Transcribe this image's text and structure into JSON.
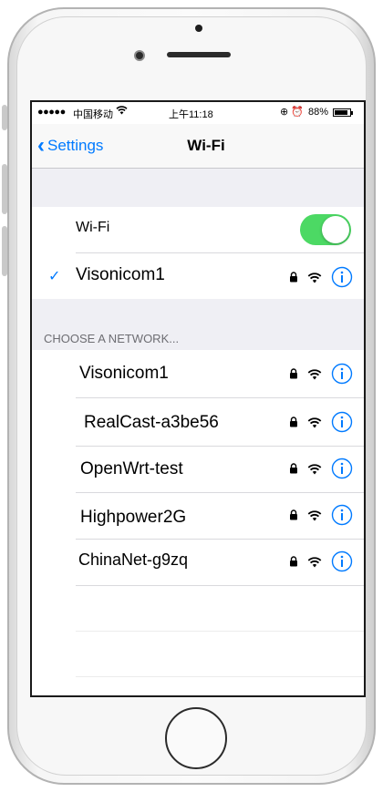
{
  "status_bar": {
    "signal": "●●●●●",
    "carrier": "中国移动",
    "time": "上午11:18",
    "battery_pct": "88%"
  },
  "nav": {
    "back_label": "Settings",
    "title": "Wi-Fi"
  },
  "wifi_toggle": {
    "label": "Wi-Fi",
    "on": true
  },
  "connected": {
    "check": "✓",
    "name": "Visonicom1"
  },
  "section_header": "CHOOSE A NETWORK...",
  "networks": [
    {
      "name": "Visonicom1"
    },
    {
      "name": "RealCast-a3be56"
    },
    {
      "name": "OpenWrt-test"
    },
    {
      "name": "Highpower2G"
    },
    {
      "name": "ChinaNet-g9zq"
    }
  ],
  "colors": {
    "accent": "#007aff",
    "toggle_on": "#4cd964",
    "group_bg": "#efeff4"
  }
}
